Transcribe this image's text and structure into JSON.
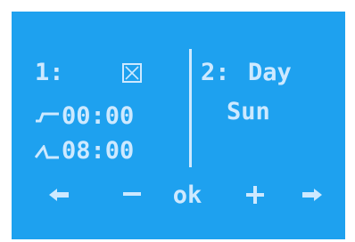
{
  "program": {
    "index_label": "1:",
    "enabled_checked": false
  },
  "times": {
    "on_time": "00:00",
    "off_time": "08:00"
  },
  "day_panel": {
    "index_label": "2:",
    "label": "Day",
    "value": "Sun"
  },
  "nav": {
    "prev_label": "←",
    "minus_label": "−",
    "ok_label": "ok",
    "plus_label": "+",
    "next_label": "→"
  },
  "colors": {
    "background": "#1ea1ef",
    "foreground": "#cde9ff"
  },
  "icons": {
    "on_edge": "falling-edge-icon",
    "off_edge": "rising-edge-icon",
    "checkbox": "checkbox-crossed-icon"
  }
}
